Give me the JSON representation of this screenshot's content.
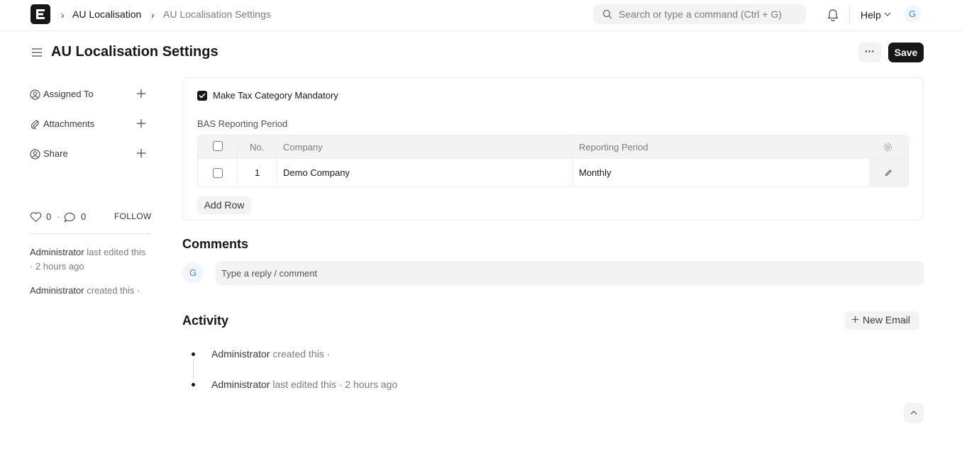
{
  "navbar": {
    "logo_icon": "frappe-e-logo-icon",
    "breadcrumbs": [
      "AU Localisation",
      "AU Localisation Settings"
    ],
    "search_placeholder": "Search or type a command (Ctrl + G)",
    "help_label": "Help",
    "user_initial": "G"
  },
  "page": {
    "title": "AU Localisation Settings",
    "more_label": "···",
    "save_label": "Save"
  },
  "sidebar": {
    "items": [
      {
        "label": "Assigned To",
        "icon": "assign-user-icon"
      },
      {
        "label": "Attachments",
        "icon": "paperclip-icon"
      },
      {
        "label": "Share",
        "icon": "share-user-icon"
      }
    ],
    "likes": "0",
    "comments": "0",
    "separator": "·",
    "follow_label": "FOLLOW",
    "edited": {
      "who": "Administrator",
      "rest": " last edited this · 2 hours ago"
    },
    "created": {
      "who": "Administrator",
      "rest": " created this ·"
    }
  },
  "form": {
    "make_tax_mandatory": {
      "label": "Make Tax Category Mandatory",
      "checked": true
    },
    "bas_label": "BAS Reporting Period",
    "table": {
      "headers": {
        "no": "No.",
        "company": "Company",
        "period": "Reporting Period"
      },
      "rows": [
        {
          "no": "1",
          "company": "Demo Company",
          "period": "Monthly"
        }
      ]
    },
    "add_row_label": "Add Row"
  },
  "comments": {
    "title": "Comments",
    "avatar_initial": "G",
    "placeholder": "Type a reply / comment"
  },
  "activity": {
    "title": "Activity",
    "new_email_label": "New Email",
    "items": [
      {
        "who": "Administrator",
        "rest": " created this ·"
      },
      {
        "who": "Administrator",
        "rest": " last edited this · 2 hours ago"
      }
    ]
  },
  "colors": {
    "accent": "#171717",
    "muted": "#7c7c7c",
    "surface": "#f3f3f3",
    "avatar_text": "#3a8fc7"
  }
}
